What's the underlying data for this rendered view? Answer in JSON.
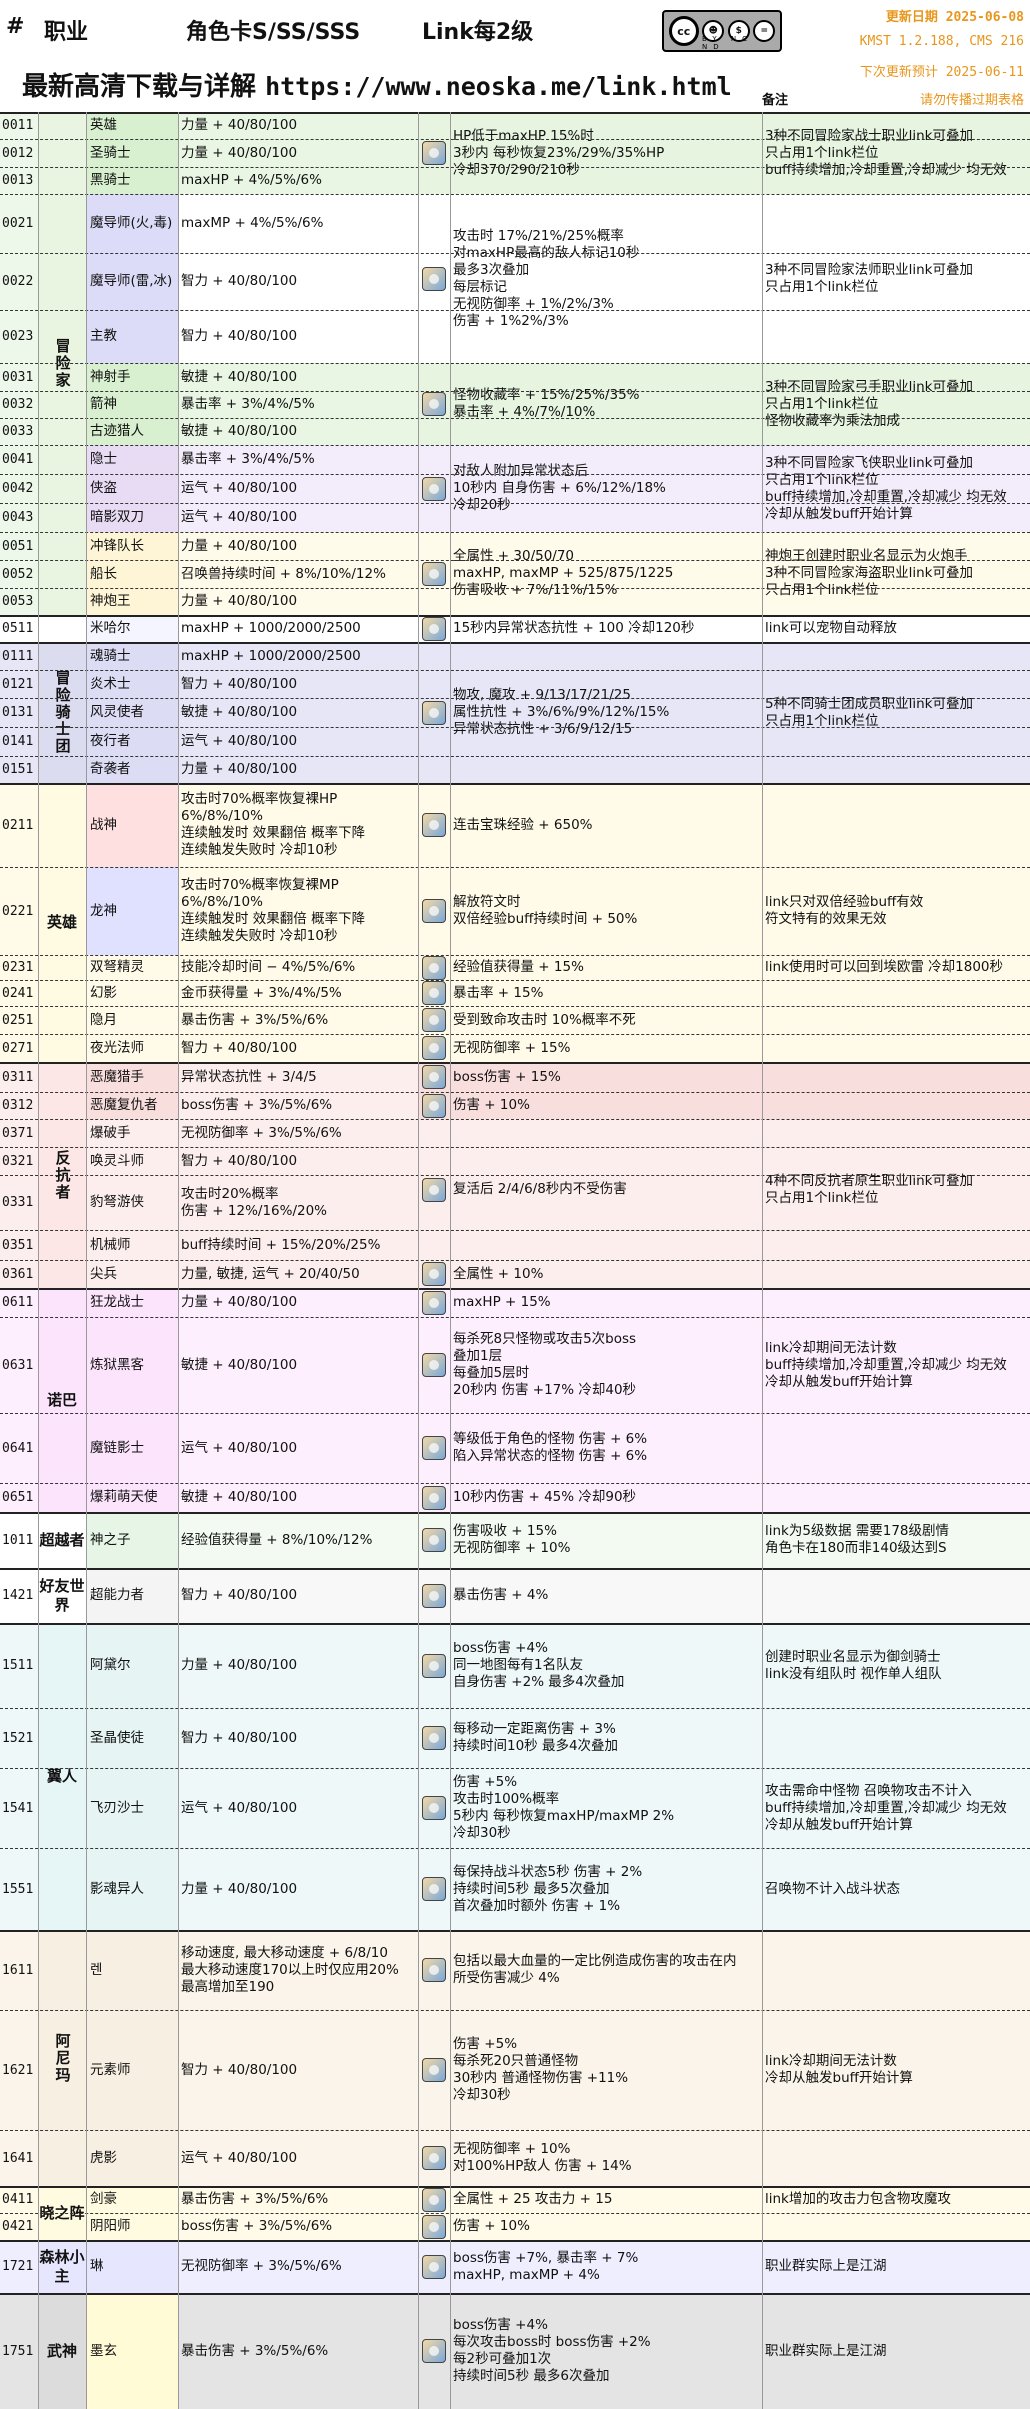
{
  "header": {
    "hash": "#",
    "col_job": "职业",
    "col_card": "角色卡S/SS/SSS",
    "col_level": "Link每2级",
    "download_label": "最新高清下载与详解",
    "download_url": "https://www.neoska.me/link.html",
    "update_date": "更新日期 2025-06-08",
    "version": "KMST 1.2.188, CMS 216",
    "next_update": "下次更新预计 2025-06-11",
    "notice": "请勿传播过期表格",
    "note_header": "备注",
    "license": "BY NC ND",
    "cc": "cc"
  },
  "colors": {
    "accent": "#e8961c",
    "explorer": "#e6f4e0",
    "cygnus": "#dcdcf0",
    "hero": "#fffbe3",
    "resistance": "#fce6e6",
    "nova": "#fce5fc",
    "jianghu": "#ececec"
  },
  "groups": [
    {
      "id": "explorer",
      "label": "冒险家",
      "bg": "#e9f5e1",
      "idbg": "#eef8ea",
      "rows": [
        {
          "id": "0011",
          "job": "英雄",
          "stat": "力量 + 40/80/100",
          "jb": "#d8f0cf",
          "sb": "#eaf6e4"
        },
        {
          "id": "0012",
          "job": "圣骑士",
          "stat": "力量 + 40/80/100",
          "jb": "#d8f0cf",
          "sb": "#eaf6e4"
        },
        {
          "id": "0013",
          "job": "黑骑士",
          "stat": "maxHP + 4%/5%/6%",
          "jb": "#d8f0cf",
          "sb": "#eaf6e4"
        },
        {
          "id": "0021",
          "job": "魔导师(火,毒)",
          "stat": "maxMP + 4%/5%/6%",
          "jb": "#dcdcf8",
          "sb": "#ffffff"
        },
        {
          "id": "0022",
          "job": "魔导师(雷,冰)",
          "stat": "智力 + 40/80/100",
          "jb": "#dcdcf8",
          "sb": "#ffffff"
        },
        {
          "id": "0023",
          "job": "主教",
          "stat": "智力 + 40/80/100",
          "jb": "#dcdcf8",
          "sb": "#ffffff"
        },
        {
          "id": "0031",
          "job": "神射手",
          "stat": "敏捷 + 40/80/100",
          "jb": "#d8f0cf",
          "sb": "#eaf6e4"
        },
        {
          "id": "0032",
          "job": "箭神",
          "stat": "暴击率 + 3%/4%/5%",
          "jb": "#d8f0cf",
          "sb": "#eaf6e4"
        },
        {
          "id": "0033",
          "job": "古迹猎人",
          "stat": "敏捷 + 40/80/100",
          "jb": "#d8f0cf",
          "sb": "#eaf6e4"
        },
        {
          "id": "0041",
          "job": "隐士",
          "stat": "暴击率 + 3%/4%/5%",
          "jb": "#e8dcf4",
          "sb": "#f3ecfa"
        },
        {
          "id": "0042",
          "job": "侠盗",
          "stat": "运气 + 40/80/100",
          "jb": "#e8dcf4",
          "sb": "#f3ecfa"
        },
        {
          "id": "0043",
          "job": "暗影双刀",
          "stat": "运气 + 40/80/100",
          "jb": "#e8dcf4",
          "sb": "#f3ecfa"
        },
        {
          "id": "0051",
          "job": "冲锋队长",
          "stat": "力量 + 40/80/100",
          "jb": "#fdf5d6",
          "sb": "#fffbea"
        },
        {
          "id": "0052",
          "job": "船长",
          "stat": "召唤兽持续时间 + 8%/10%/12%",
          "jb": "#fdf5d6",
          "sb": "#fffbea"
        },
        {
          "id": "0053",
          "job": "神炮王",
          "stat": "力量 + 40/80/100",
          "jb": "#fdf5d6",
          "sb": "#fffbea"
        }
      ]
    },
    {
      "id": "other",
      "label": "",
      "bg": "#ffffff",
      "idbg": "#ffffff",
      "rows": [
        {
          "id": "0511",
          "job": "米哈尔",
          "stat": "maxHP + 1000/2000/2500",
          "jb": "#f5f5ff",
          "sb": "#ffffff"
        }
      ]
    },
    {
      "id": "cygnus",
      "label": "冒险骑士团",
      "bg": "#dcdcf0",
      "idbg": "#e6e6f6",
      "rows": [
        {
          "id": "0111",
          "job": "魂骑士",
          "stat": "maxHP + 1000/2000/2500",
          "jb": "#dcdcf4",
          "sb": "#e6e6f6"
        },
        {
          "id": "0121",
          "job": "炎术士",
          "stat": "智力 + 40/80/100",
          "jb": "#dcdcf4",
          "sb": "#e6e6f6"
        },
        {
          "id": "0131",
          "job": "风灵使者",
          "stat": "敏捷 + 40/80/100",
          "jb": "#dcdcf4",
          "sb": "#e6e6f6"
        },
        {
          "id": "0141",
          "job": "夜行者",
          "stat": "运气 + 40/80/100",
          "jb": "#dcdcf4",
          "sb": "#e6e6f6"
        },
        {
          "id": "0151",
          "job": "奇袭者",
          "stat": "力量 + 40/80/100",
          "jb": "#dcdcf4",
          "sb": "#e6e6f6"
        }
      ]
    },
    {
      "id": "hero",
      "label": "英雄",
      "bg": "#fffbe3",
      "idbg": "#fffbe8",
      "rows": [
        {
          "id": "0211",
          "job": "战神",
          "stat": "攻击时70%概率恢复裸HP\n6%/8%/10%\n连续触发时 效果翻倍 概率下降\n连续触发失败时 冷却10秒",
          "jb": "#ffe0e0",
          "sb": "#fffbe8"
        },
        {
          "id": "0221",
          "job": "龙神",
          "stat": "攻击时70%概率恢复裸MP\n6%/8%/10%\n连续触发时 效果翻倍 概率下降\n连续触发失败时 冷却10秒",
          "jb": "#e0e0ff",
          "sb": "#fffbe8"
        },
        {
          "id": "0231",
          "job": "双弩精灵",
          "stat": "技能冷却时间 − 4%/5%/6%",
          "jb": "#fffbe8",
          "sb": "#fffbe8"
        },
        {
          "id": "0241",
          "job": "幻影",
          "stat": "金币获得量 + 3%/4%/5%",
          "jb": "#fffbe8",
          "sb": "#fffbe8"
        },
        {
          "id": "0251",
          "job": "隐月",
          "stat": "暴击伤害 + 3%/5%/6%",
          "jb": "#fffbe8",
          "sb": "#fffbe8"
        },
        {
          "id": "0271",
          "job": "夜光法师",
          "stat": "智力 + 40/80/100",
          "jb": "#fffbe8",
          "sb": "#fffbe8"
        }
      ]
    },
    {
      "id": "resistance",
      "label": "反抗者",
      "bg": "#fce6e6",
      "idbg": "#fdeeee",
      "rows": [
        {
          "id": "0311",
          "job": "恶魔猎手",
          "stat": "异常状态抗性 + 3/4/5",
          "jb": "#f9dede",
          "sb": "#fdeeee"
        },
        {
          "id": "0312",
          "job": "恶魔复仇者",
          "stat": "boss伤害 + 3%/5%/6%",
          "jb": "#f9dede",
          "sb": "#fdeeee"
        },
        {
          "id": "0371",
          "job": "爆破手",
          "stat": "无视防御率 + 3%/5%/6%",
          "jb": "#fdeeee",
          "sb": "#fdeeee"
        },
        {
          "id": "0321",
          "job": "唤灵斗师",
          "stat": "智力 + 40/80/100",
          "jb": "#fdeeee",
          "sb": "#fdeeee"
        },
        {
          "id": "0331",
          "job": "豹弩游侠",
          "stat": "攻击时20%概率\n伤害 + 12%/16%/20%",
          "jb": "#fdeeee",
          "sb": "#fdeeee"
        },
        {
          "id": "0351",
          "job": "机械师",
          "stat": "buff持续时间 + 15%/20%/25%",
          "jb": "#fdeeee",
          "sb": "#fdeeee"
        },
        {
          "id": "0361",
          "job": "尖兵",
          "stat": "力量, 敏捷, 运气 + 20/40/50",
          "jb": "#fdeeee",
          "sb": "#fdeeee"
        }
      ]
    },
    {
      "id": "nova",
      "label": "诺巴",
      "bg": "#fce5fc",
      "idbg": "#fdeffd",
      "rows": [
        {
          "id": "0611",
          "job": "狂龙战士",
          "stat": "力量 + 40/80/100",
          "jb": "#fce5fc",
          "sb": "#fdeffd"
        },
        {
          "id": "0631",
          "job": "炼狱黑客",
          "stat": "敏捷 + 40/80/100",
          "jb": "#fce5fc",
          "sb": "#fdeffd"
        },
        {
          "id": "0641",
          "job": "魔链影士",
          "stat": "运气 + 40/80/100",
          "jb": "#fce5fc",
          "sb": "#fdeffd"
        },
        {
          "id": "0651",
          "job": "爆莉萌天使",
          "stat": "敏捷 + 40/80/100",
          "jb": "#fce5fc",
          "sb": "#fdeffd"
        }
      ]
    },
    {
      "id": "ultimate",
      "label": "超越者",
      "bg": "#ffffff",
      "idbg": "#ffffff",
      "rows": [
        {
          "id": "1011",
          "job": "神之子",
          "stat": "经验值获得量 + 8%/10%/12%",
          "jb": "#e6f5e6",
          "sb": "#f2faf2"
        }
      ]
    },
    {
      "id": "friends",
      "label": "好友世界",
      "bg": "#ffffff",
      "idbg": "#ffffff",
      "rows": [
        {
          "id": "1421",
          "job": "超能力者",
          "stat": "智力 + 40/80/100",
          "jb": "#f4f4f4",
          "sb": "#f8f8f8"
        }
      ]
    },
    {
      "id": "flora",
      "label": "翼人",
      "bg": "#e6f6f6",
      "idbg": "#eef8f8",
      "rows": [
        {
          "id": "1511",
          "job": "阿黛尔",
          "stat": "力量 + 40/80/100",
          "jb": "#e6f4f4",
          "sb": "#eef8f8"
        },
        {
          "id": "1521",
          "job": "圣晶使徒",
          "stat": "智力 + 40/80/100",
          "jb": "#e6f4f4",
          "sb": "#eef8f8"
        },
        {
          "id": "1541",
          "job": "飞刃沙士",
          "stat": "运气 + 40/80/100",
          "jb": "#e6f4f4",
          "sb": "#eef8f8"
        },
        {
          "id": "1551",
          "job": "影魂异人",
          "stat": "力量 + 40/80/100",
          "jb": "#e6f4f4",
          "sb": "#eef8f8"
        }
      ]
    },
    {
      "id": "anima",
      "label": "阿尼玛",
      "bg": "#f6efe2",
      "idbg": "#faf4ea",
      "rows": [
        {
          "id": "1611",
          "job": "렌",
          "stat": "移动速度, 最大移动速度 + 6/8/10\n最大移动速度170以上时仅应用20%\n最高增加至190",
          "jb": "#f6efe2",
          "sb": "#faf4ea"
        },
        {
          "id": "1621",
          "job": "元素师",
          "stat": "智力 + 40/80/100",
          "jb": "#f6efe2",
          "sb": "#faf4ea"
        },
        {
          "id": "1641",
          "job": "虎影",
          "stat": "运气 + 40/80/100",
          "jb": "#f6efe2",
          "sb": "#faf4ea"
        }
      ]
    },
    {
      "id": "sengoku",
      "label": "晓之阵",
      "bg": "#fffbe0",
      "idbg": "#fffbe8",
      "rows": [
        {
          "id": "0411",
          "job": "剑豪",
          "stat": "暴击伤害 + 3%/5%/6%",
          "jb": "#fffbe0",
          "sb": "#fffbe8"
        },
        {
          "id": "0421",
          "job": "阴阳师",
          "stat": "boss伤害 + 3%/5%/6%",
          "jb": "#fffbe0",
          "sb": "#fffbe8"
        }
      ]
    },
    {
      "id": "forest",
      "label": "森林小主",
      "bg": "#e6e6ff",
      "idbg": "#eeeeff",
      "rows": [
        {
          "id": "1721",
          "job": "琳",
          "stat": "无视防御率 + 3%/5%/6%",
          "jb": "#e6e6ff",
          "sb": "#eeeeff"
        }
      ]
    },
    {
      "id": "jianghu",
      "label": "武神",
      "bg": "#dcdcdc",
      "idbg": "#e4e4e4",
      "rows": [
        {
          "id": "1751",
          "job": "墨玄",
          "stat": "暴击伤害 + 3%/5%/6%",
          "jb": "#fffbd6",
          "sb": "#e4e4e4"
        }
      ]
    }
  ],
  "skills": [
    {
      "text": "HP低于maxHP 15%时\n3秒内 每秒恢复23%/29%/35%HP\n冷却370/290/210秒",
      "note": "3种不同冒险家战士职业link可叠加\n只占用1个link栏位\nbuff持续增加,冷却重置,冷却减少 均无效",
      "bg": "#e6f4e0",
      "icon": "warrior-link-icon"
    },
    {
      "text": "攻击时 17%/21%/25%概率\n对maxHP最高的敌人标记10秒\n最多3次叠加\n每层标记\n无视防御率 + 1%/2%/3%\n伤害 + 1%2%/3%",
      "note": "3种不同冒险家法师职业link可叠加\n只占用1个link栏位",
      "bg": "#ffffff",
      "icon": "mage-link-icon"
    },
    {
      "text": "怪物收藏率 + 15%/25%/35%\n暴击率 + 4%/7%/10%",
      "note": "3种不同冒险家弓手职业link可叠加\n只占用1个link栏位\n怪物收藏率为乘法加成",
      "bg": "#e6f4e0",
      "icon": "archer-link-icon"
    },
    {
      "text": "对敌人附加异常状态后\n10秒内 自身伤害 + 6%/12%/18%\n冷却20秒",
      "note": "3种不同冒险家飞侠职业link可叠加\n只占用1个link栏位\nbuff持续增加,冷却重置,冷却减少 均无效\n冷却从触发buff开始计算",
      "bg": "#f3ecfa",
      "icon": "thief-link-icon"
    },
    {
      "text": "全属性 + 30/50/70\nmaxHP, maxMP + 525/875/1225\n伤害吸收 + 7%/11%/15%",
      "note": "神炮王创建时职业名显示为火炮手\n3种不同冒险家海盗职业link可叠加\n只占用1个link栏位",
      "bg": "#fffbea",
      "icon": "pirate-link-icon"
    },
    {
      "text": "15秒内异常状态抗性 + 100 冷却120秒",
      "note": "link可以宠物自动释放",
      "bg": "#ffffff",
      "icon": "mihile-link-icon"
    },
    {
      "text": "物攻, 魔攻 + 9/13/17/21/25\n属性抗性 + 3%/6%/9%/12%/15%\n异常状态抗性 + 3/6/9/12/15",
      "note": "5种不同骑士团成员职业link可叠加\n只占用1个link栏位",
      "bg": "#e6e6f6",
      "icon": "cygnus-link-icon"
    },
    {
      "text": "连击宝珠经验 + 650%",
      "note": "",
      "bg": "#fffbe8",
      "icon": "aran-link-icon"
    },
    {
      "text": "解放符文时\n双倍经验buff持续时间 + 50%",
      "note": "link只对双倍经验buff有效\n符文特有的效果无效",
      "bg": "#fffbe8",
      "icon": "evan-link-icon"
    },
    {
      "text": "经验值获得量 + 15%",
      "note": "link使用时可以回到埃欧雷 冷却1800秒",
      "bg": "#fffbe8",
      "icon": "mercedes-link-icon"
    },
    {
      "text": "暴击率 + 15%",
      "note": "",
      "bg": "#fffbe8",
      "icon": "phantom-link-icon"
    },
    {
      "text": "受到致命攻击时 10%概率不死",
      "note": "",
      "bg": "#fffbe8",
      "icon": "shade-link-icon"
    },
    {
      "text": "无视防御率 + 15%",
      "note": "",
      "bg": "#fffbe8",
      "icon": "luminous-link-icon"
    },
    {
      "text": "boss伤害 + 15%",
      "note": "",
      "bg": "#f9dede",
      "icon": "demon-slayer-link-icon"
    },
    {
      "text": "伤害 + 10%",
      "note": "",
      "bg": "#f9dede",
      "icon": "demon-avenger-link-icon"
    },
    {
      "text": "复活后 2/4/6/8秒内不受伤害",
      "note": "4种不同反抗者原生职业link可叠加\n只占用1个link栏位",
      "bg": "#fdeeee",
      "icon": "resistance-link-icon"
    },
    {
      "text": "全属性 + 10%",
      "note": "",
      "bg": "#fdeeee",
      "icon": "xenon-link-icon"
    },
    {
      "text": "maxHP + 15%",
      "note": "",
      "bg": "#fdeffd",
      "icon": "kaiser-link-icon"
    },
    {
      "text": "每杀死8只怪物或攻击5次boss\n叠加1层\n每叠加5层时\n20秒内 伤害 +17% 冷却40秒",
      "note": "link冷却期间无法计数\nbuff持续增加,冷却重置,冷却减少 均无效\n冷却从触发buff开始计算",
      "bg": "#fdeffd",
      "icon": "cadena-link-icon"
    },
    {
      "text": "等级低于角色的怪物 伤害 + 6%\n陷入异常状态的怪物 伤害 + 6%",
      "note": "",
      "bg": "#fdeffd",
      "icon": "cadena2-link-icon"
    },
    {
      "text": "10秒内伤害 + 45% 冷却90秒",
      "note": "",
      "bg": "#fdeffd",
      "icon": "angelic-buster-link-icon"
    },
    {
      "text": "伤害吸收 + 15%\n无视防御率 + 10%",
      "note": "link为5级数据 需要178级剧情\n角色卡在180而非140级达到S",
      "bg": "#f2faf2",
      "icon": "zero-link-icon"
    },
    {
      "text": "暴击伤害 + 4%",
      "note": "",
      "bg": "#f8f8f8",
      "icon": "kinesis-link-icon"
    },
    {
      "text": "boss伤害 +4%\n同一地图每有1名队友\n自身伤害 +2% 最多4次叠加",
      "note": "创建时职业名显示为御剑骑士\nlink没有组队时 视作单人组队",
      "bg": "#eef8f8",
      "icon": "adele-link-icon"
    },
    {
      "text": "每移动一定距离伤害 + 3%\n持续时间10秒 最多4次叠加",
      "note": "",
      "bg": "#eef8f8",
      "icon": "illium-link-icon"
    },
    {
      "text": "伤害 +5%\n攻击时100%概率\n5秒内 每秒恢复maxHP/maxMP 2%\n冷却30秒",
      "note": "攻击需命中怪物 召唤物攻击不计入\nbuff持续增加,冷却重置,冷却减少 均无效\n冷却从触发buff开始计算",
      "bg": "#eef8f8",
      "icon": "khali-link-icon"
    },
    {
      "text": "每保持战斗状态5秒 伤害 + 2%\n持续时间5秒 最多5次叠加\n首次叠加时额外 伤害 + 1%",
      "note": "召唤物不计入战斗状态",
      "bg": "#eef8f8",
      "icon": "ark-link-icon"
    },
    {
      "text": "包括以最大血量的一定比例造成伤害的攻击在内\n所受伤害减少 4%",
      "note": "",
      "bg": "#faf4ea",
      "icon": "ren-link-icon"
    },
    {
      "text": "伤害 +5%\n每杀死20只普通怪物\n30秒内 普通怪物伤害 +11%\n冷却30秒",
      "note": "link冷却期间无法计数\n冷却从触发buff开始计算",
      "bg": "#faf4ea",
      "icon": "lara-link-icon"
    },
    {
      "text": "无视防御率 + 10%\n对100%HP敌人 伤害 + 14%",
      "note": "",
      "bg": "#faf4ea",
      "icon": "hoyoung-link-icon"
    },
    {
      "text": "全属性 + 25 攻击力 + 15",
      "note": "link增加的攻击力包含物攻魔攻",
      "bg": "#fffbe8",
      "icon": "hayato-link-icon"
    },
    {
      "text": "伤害 + 10%",
      "note": "",
      "bg": "#fffbe8",
      "icon": "kanna-link-icon"
    },
    {
      "text": "boss伤害 +7%, 暴击率 + 7%\nmaxHP, maxMP + 4%",
      "note": "职业群实际上是江湖",
      "bg": "#eeeeff",
      "icon": "lynn-link-icon"
    },
    {
      "text": "boss伤害 +4%\n每次攻击boss时 boss伤害 +2%\n每2秒可叠加1次\n持续时间5秒 最多6次叠加",
      "note": "职业群实际上是江湖",
      "bg": "#e4e4e4",
      "icon": "mo-xuan-link-icon"
    }
  ]
}
